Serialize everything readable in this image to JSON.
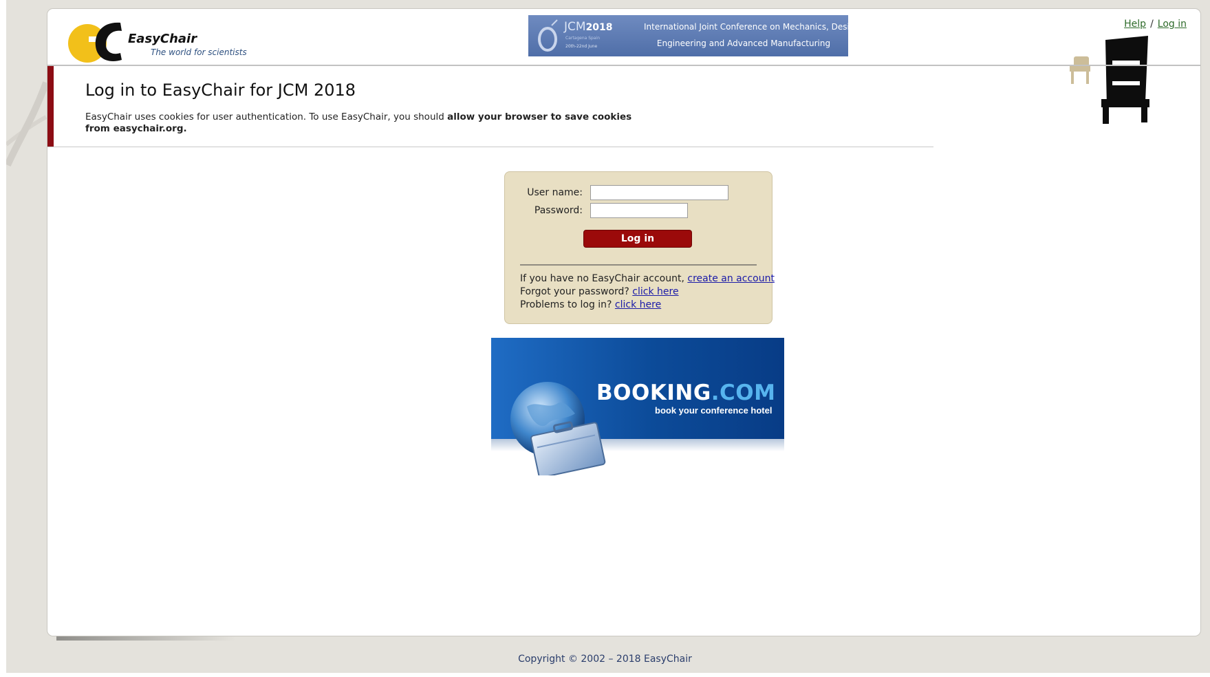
{
  "header": {
    "logo_title": "EasyChair",
    "logo_tagline": "The world for scientists",
    "help_link": "Help",
    "link_separator": "/",
    "login_link": "Log in"
  },
  "conference_banner": {
    "acronym": "JCM",
    "year": "2018",
    "city": "Cartagena Spain",
    "dates": "20th-22nd June",
    "line1": "International Joint Conference on Mechanics, Design",
    "line2": "Engineering and Advanced Manufacturing"
  },
  "main": {
    "title": "Log in to EasyChair for JCM 2018",
    "cookie_text": "EasyChair uses cookies for user authentication. To use EasyChair, you should ",
    "cookie_bold": "allow your browser to save cookies from easychair.org."
  },
  "login_form": {
    "username_label": "User name:",
    "username_value": "",
    "password_label": "Password:",
    "password_value": "",
    "submit_label": "Log in",
    "no_account_text": "If you have no EasyChair account, ",
    "no_account_link": "create an account",
    "forgot_text": "Forgot your password? ",
    "forgot_link": "click here",
    "problems_text": "Problems to log in? ",
    "problems_link": "click here"
  },
  "booking_banner": {
    "name_main": "BOOKING",
    "name_dot": ".COM",
    "tagline": "book your conference hotel"
  },
  "footer": {
    "copyright": "Copyright © 2002 – 2018 EasyChair"
  },
  "colors": {
    "accent_red": "#9b0a0a",
    "login_box_bg": "#e8dfc3",
    "link_blue": "#1a1aa8",
    "header_link_green": "#2e6b2a",
    "logo_yellow": "#f2c01a"
  },
  "icons": [
    "easychair-logo",
    "easychair-chair-icon",
    "globe-suitcase-icon",
    "conference-ring-icon"
  ]
}
